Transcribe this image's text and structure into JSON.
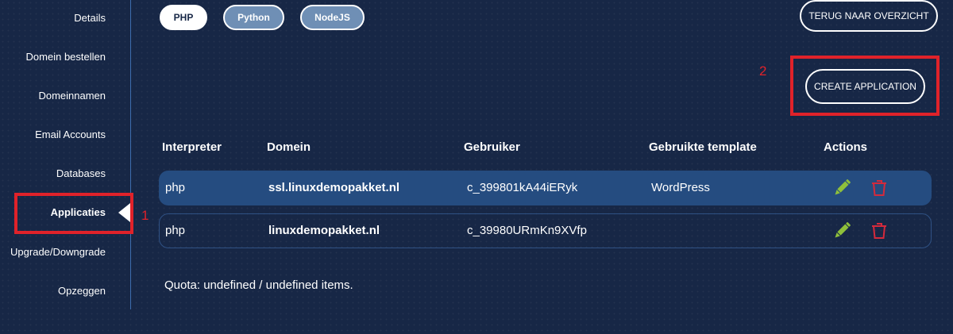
{
  "sidebar": {
    "items": [
      {
        "label": "Details"
      },
      {
        "label": "Domein bestellen"
      },
      {
        "label": "Domeinnamen"
      },
      {
        "label": "Email Accounts"
      },
      {
        "label": "Databases"
      },
      {
        "label": "Applicaties",
        "active": true
      },
      {
        "label": "Upgrade/Downgrade"
      },
      {
        "label": "Opzeggen"
      }
    ]
  },
  "annotations": {
    "step1": "1",
    "step2": "2",
    "color": "#e0222a"
  },
  "tabs": [
    {
      "label": "PHP",
      "active": true
    },
    {
      "label": "Python",
      "active": false
    },
    {
      "label": "NodeJS",
      "active": false
    }
  ],
  "header": {
    "back_label": "TERUG NAAR OVERZICHT",
    "create_label": "CREATE APPLICATION"
  },
  "table": {
    "columns": [
      "Interpreter",
      "Domein",
      "Gebruiker",
      "Gebruikte template",
      "Actions"
    ],
    "rows": [
      {
        "interpreter": "php",
        "domain": "ssl.linuxdemopakket.nl",
        "user": "c_399801kA44iERyk",
        "template": "WordPress",
        "actions": [
          "pencil-icon",
          "trash-icon"
        ]
      },
      {
        "interpreter": "php",
        "domain": "linuxdemopakket.nl",
        "user": "c_39980URmKn9XVfp",
        "template": "",
        "actions": [
          "pencil-icon",
          "trash-icon"
        ]
      }
    ]
  },
  "quota": {
    "prefix": "Quota: ",
    "used": "undefined",
    "separator": " / ",
    "total": "undefined",
    "suffix": " items."
  },
  "colors": {
    "background": "#172746",
    "accent": "#3d6cae",
    "row_highlight": "#254c80",
    "edit_icon": "#8fc03b",
    "delete_icon": "#d42a3c"
  }
}
